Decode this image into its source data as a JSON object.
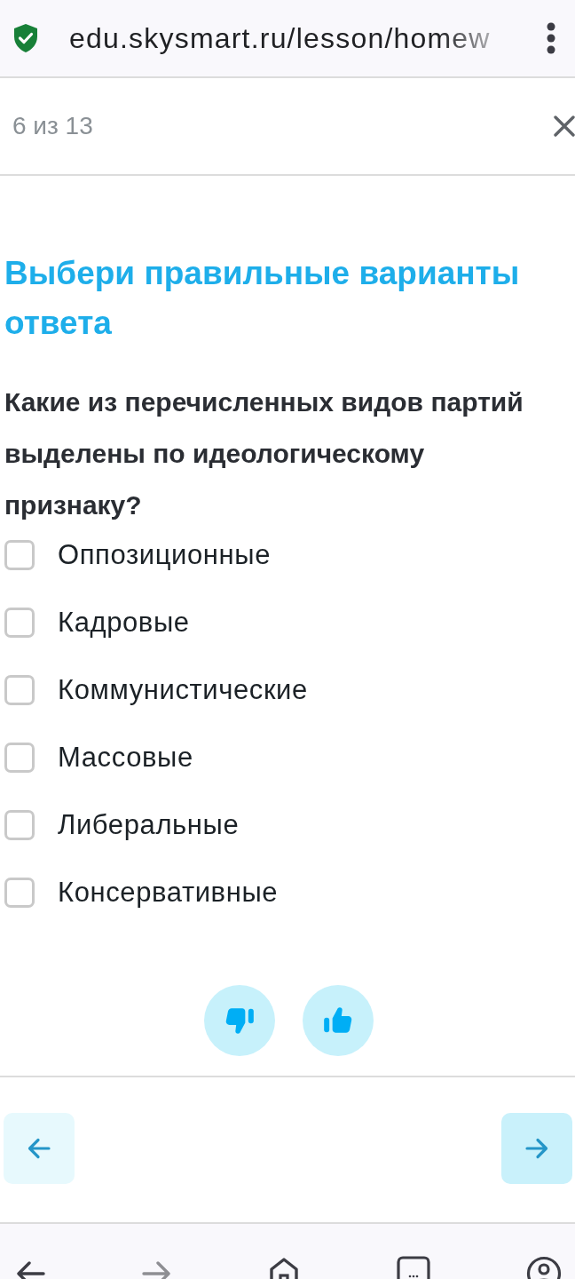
{
  "browser": {
    "url": "edu.skysmart.ru/lesson/homew"
  },
  "header": {
    "progress": "6 из 13"
  },
  "task": {
    "title": "Выбери правильные варианты ответа",
    "question": "Какие из перечисленных видов партий выделены по идеологическому признаку?"
  },
  "options": [
    {
      "label": "Оппозиционные",
      "checked": false
    },
    {
      "label": "Кадровые",
      "checked": false
    },
    {
      "label": "Коммунистические",
      "checked": false
    },
    {
      "label": "Массовые",
      "checked": false
    },
    {
      "label": "Либеральные",
      "checked": false
    },
    {
      "label": "Консервативные",
      "checked": false
    }
  ],
  "nav": [
    {
      "kind": "prev",
      "highlighted": false
    },
    {
      "kind": "next",
      "highlighted": true
    }
  ]
}
